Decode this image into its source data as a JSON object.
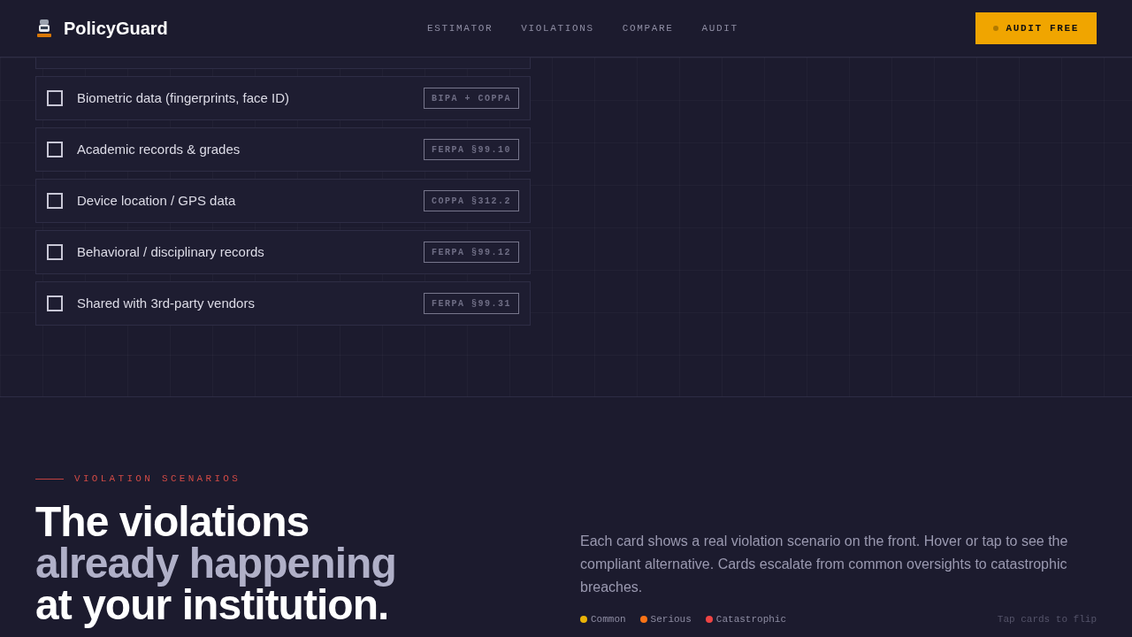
{
  "nav": {
    "brand": "PolicyGuard",
    "links": [
      "ESTIMATOR",
      "VIOLATIONS",
      "COMPARE",
      "AUDIT"
    ],
    "cta": "AUDIT FREE"
  },
  "data_types": [
    {
      "label": "Biometric data (fingerprints, face ID)",
      "tag": "BIPA + COPPA",
      "checked": false
    },
    {
      "label": "Academic records & grades",
      "tag": "FERPA §99.10",
      "checked": false
    },
    {
      "label": "Device location / GPS data",
      "tag": "COPPA §312.2",
      "checked": false
    },
    {
      "label": "Behavioral / disciplinary records",
      "tag": "FERPA §99.12",
      "checked": false
    },
    {
      "label": "Shared with 3rd-party vendors",
      "tag": "FERPA §99.31",
      "checked": false
    }
  ],
  "violations": {
    "eyebrow": "VIOLATION SCENARIOS",
    "heading": [
      "The violations",
      "already happening",
      "at your institution."
    ],
    "intro": "Each card shows a real violation scenario on the front. Hover or tap to see the compliant alternative. Cards escalate from common oversights to catastrophic breaches.",
    "legend": [
      {
        "label": "Common",
        "color": "#eab308"
      },
      {
        "label": "Serious",
        "color": "#f97316"
      },
      {
        "label": "Catastrophic",
        "color": "#ef4444"
      }
    ],
    "hint": "Tap cards to flip"
  }
}
